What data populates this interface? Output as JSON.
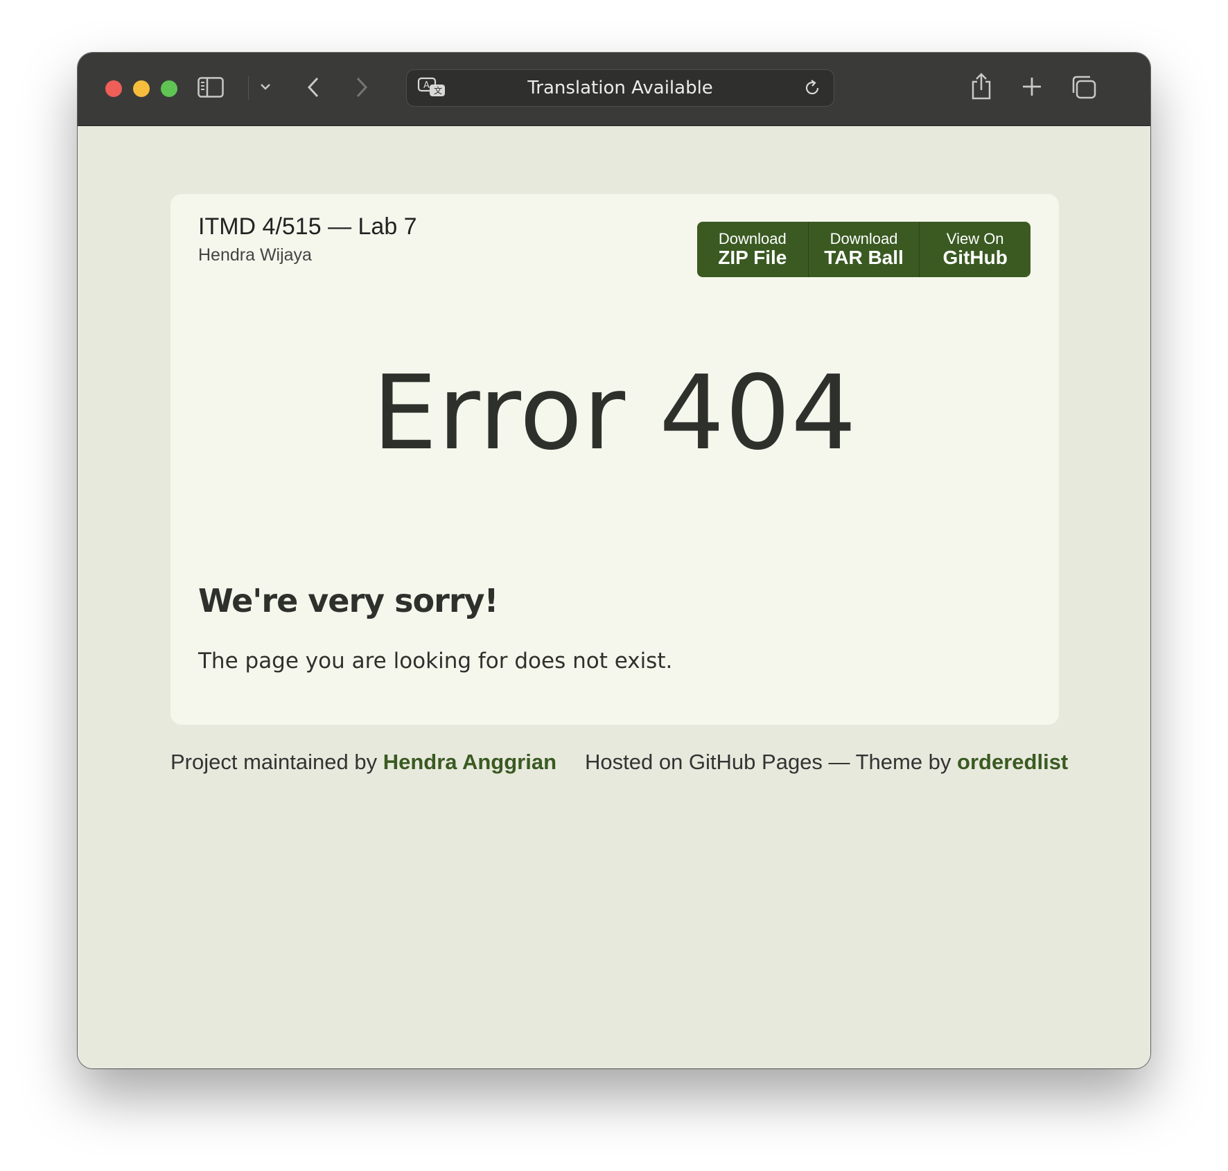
{
  "browser": {
    "address_text": "Translation Available",
    "icons": {
      "sidebar": "sidebar-icon",
      "sidebar_menu": "chevron-down-icon",
      "back": "chevron-left-icon",
      "forward": "chevron-right-icon",
      "translate": "translate-icon",
      "reload": "reload-icon",
      "share": "share-icon",
      "new_tab": "plus-icon",
      "tabs": "tabs-overview-icon"
    }
  },
  "header": {
    "title": "ITMD 4/515 — Lab 7",
    "author": "Hendra Wijaya"
  },
  "downloads": [
    {
      "small": "Download",
      "big": "ZIP File"
    },
    {
      "small": "Download",
      "big": "TAR Ball"
    },
    {
      "small": "View On",
      "big": "GitHub"
    }
  ],
  "main": {
    "error_title": "Error 404",
    "sorry_heading": "We're very sorry!",
    "message": "The page you are looking for does not exist."
  },
  "footer": {
    "maintained_prefix": "Project maintained by ",
    "maintainer": "Hendra Anggrian",
    "hosted_prefix": "Hosted on GitHub Pages — Theme by ",
    "theme_author": "orderedlist"
  },
  "colors": {
    "accent": "#3a5a22",
    "page_bg": "#e8e9dd",
    "card_bg": "#f5f6ec",
    "toolbar_bg": "#3a3b39"
  }
}
